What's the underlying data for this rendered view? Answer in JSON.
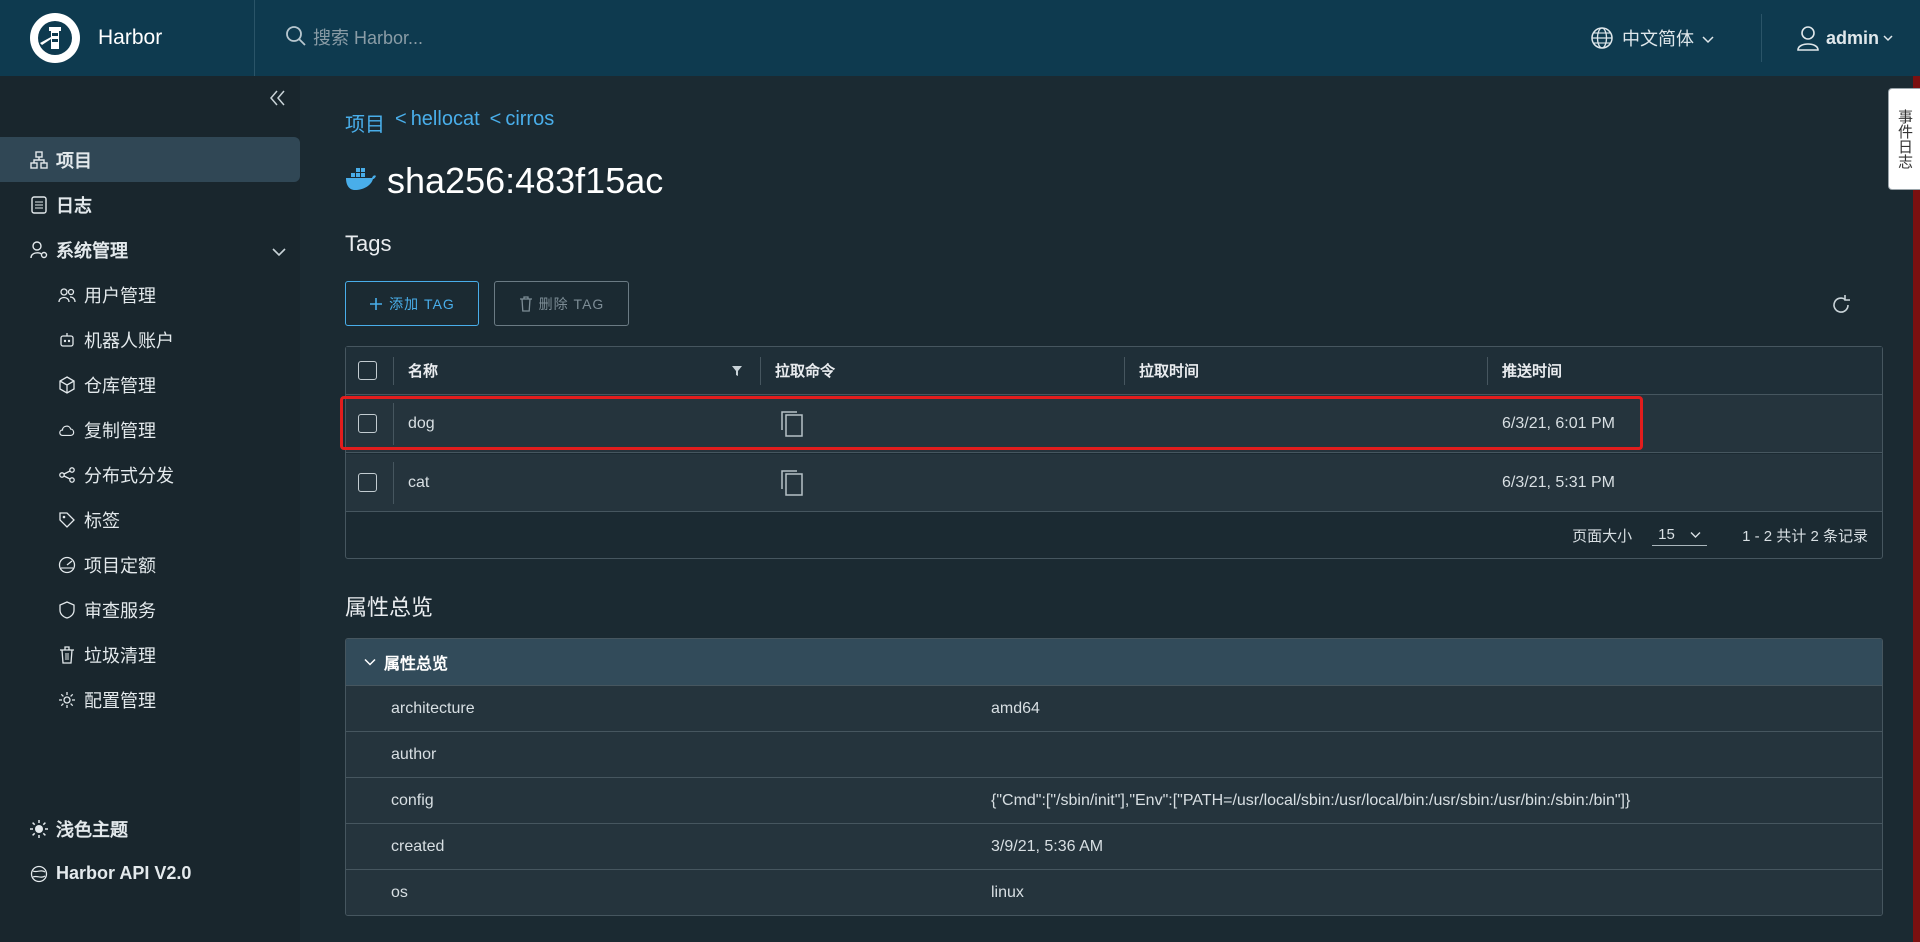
{
  "header": {
    "brand": "Harbor",
    "search_placeholder": "搜索 Harbor...",
    "language": "中文简体",
    "user": "admin"
  },
  "sidebar": {
    "items": [
      {
        "label": "项目",
        "icon": "project-icon"
      },
      {
        "label": "日志",
        "icon": "log-icon"
      },
      {
        "label": "系统管理",
        "icon": "admin-icon"
      },
      {
        "label": "用户管理",
        "icon": "users-icon"
      },
      {
        "label": "机器人账户",
        "icon": "robot-icon"
      },
      {
        "label": "仓库管理",
        "icon": "registry-icon"
      },
      {
        "label": "复制管理",
        "icon": "replication-icon"
      },
      {
        "label": "分布式分发",
        "icon": "distribution-icon"
      },
      {
        "label": "标签",
        "icon": "tag-icon"
      },
      {
        "label": "项目定额",
        "icon": "quota-icon"
      },
      {
        "label": "审查服务",
        "icon": "shield-icon"
      },
      {
        "label": "垃圾清理",
        "icon": "trash-icon"
      },
      {
        "label": "配置管理",
        "icon": "gear-icon"
      }
    ],
    "bottom": [
      {
        "label": "浅色主题",
        "icon": "sun-icon"
      },
      {
        "label": "Harbor API V2.0",
        "icon": "api-icon"
      }
    ]
  },
  "breadcrumb": {
    "items": [
      "项目",
      "hellocat",
      "cirros"
    ],
    "separator": "<"
  },
  "page": {
    "title": "sha256:483f15ac"
  },
  "tags": {
    "section_title": "Tags",
    "add_label": "添加 TAG",
    "delete_label": "删除 TAG",
    "columns": [
      "名称",
      "拉取命令",
      "拉取时间",
      "推送时间"
    ],
    "rows": [
      {
        "name": "dog",
        "pull_time": "",
        "push_time": "6/3/21, 6:01 PM"
      },
      {
        "name": "cat",
        "pull_time": "",
        "push_time": "6/3/21, 5:31 PM"
      }
    ],
    "footer": {
      "page_size_label": "页面大小",
      "page_size": "15",
      "summary": "1 - 2 共计 2 条记录"
    }
  },
  "properties": {
    "section_title": "属性总览",
    "panel_title": "属性总览",
    "rows": [
      {
        "key": "architecture",
        "value": "amd64"
      },
      {
        "key": "author",
        "value": ""
      },
      {
        "key": "config",
        "value": "{\"Cmd\":[\"/sbin/init\"],\"Env\":[\"PATH=/usr/local/sbin:/usr/local/bin:/usr/sbin:/usr/bin:/sbin:/bin\"]}"
      },
      {
        "key": "created",
        "value": "3/9/21, 5:36 AM"
      },
      {
        "key": "os",
        "value": "linux"
      }
    ]
  },
  "event_log": {
    "label": "事件日志"
  },
  "colors": {
    "header_bg": "#0e3a4f",
    "sidebar_bg": "#19262d",
    "main_bg": "#1b2a32",
    "link": "#49aeea",
    "highlight": "#e21d1d"
  }
}
